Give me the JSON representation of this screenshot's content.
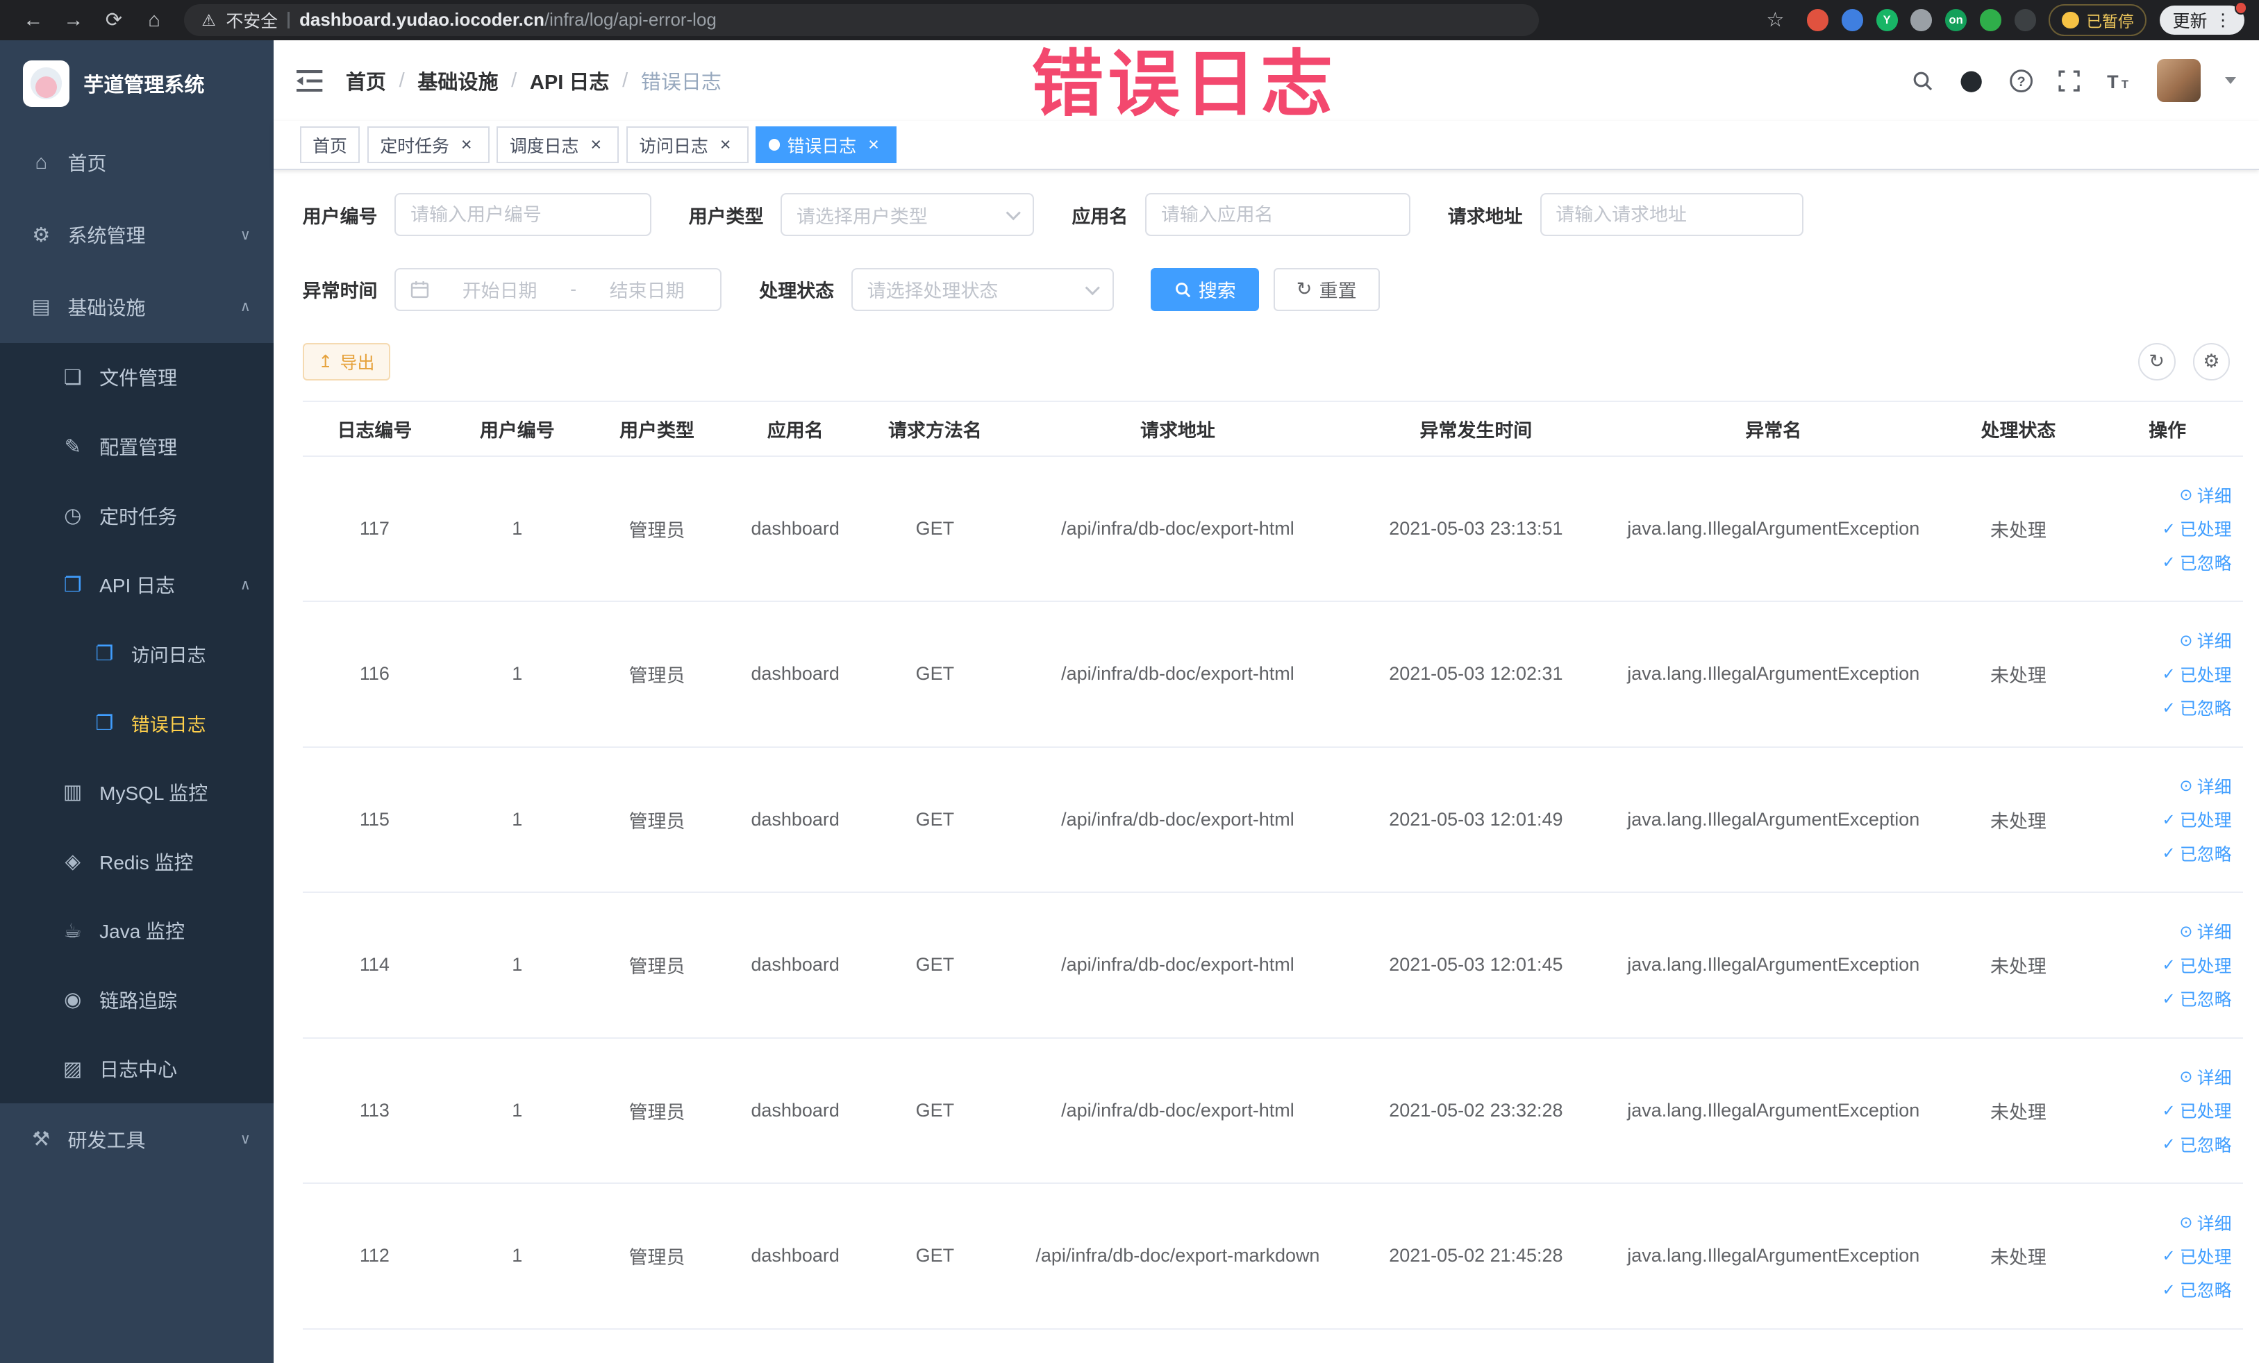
{
  "browser": {
    "security_label": "不安全",
    "url_host": "dashboard.yudao.iocoder.cn",
    "url_path": "/infra/log/api-error-log",
    "paused_badge": "已暂停",
    "update_label": "更新",
    "extensions": [
      {
        "name": "extension-red",
        "color": "#e0523f",
        "label": ""
      },
      {
        "name": "extension-blue",
        "color": "#3f7fe0",
        "label": ""
      },
      {
        "name": "extension-teal",
        "color": "#18b566",
        "label": "Y"
      },
      {
        "name": "extension-gray-puzzle",
        "color": "#9aa0a6",
        "label": ""
      },
      {
        "name": "extension-on-switch",
        "color": "#14a05a",
        "label": "on"
      },
      {
        "name": "extension-green",
        "color": "#2fae4a",
        "label": ""
      },
      {
        "name": "extension-dark",
        "color": "#3c4043",
        "label": ""
      }
    ]
  },
  "sidebar": {
    "title": "芋道管理系统",
    "items": [
      {
        "label": "首页",
        "icon": "home-icon",
        "glyph": "⌂",
        "level": 1
      },
      {
        "label": "系统管理",
        "icon": "gear-icon",
        "glyph": "⚙",
        "level": 1,
        "arrow": "down"
      },
      {
        "label": "基础设施",
        "icon": "infrastructure-icon",
        "glyph": "▤",
        "level": 1,
        "arrow": "up"
      },
      {
        "label": "文件管理",
        "icon": "file-manage-icon",
        "glyph": "❏",
        "level": 2
      },
      {
        "label": "配置管理",
        "icon": "config-manage-icon",
        "glyph": "✎",
        "level": 2
      },
      {
        "label": "定时任务",
        "icon": "scheduled-job-icon",
        "glyph": "◷",
        "level": 2
      },
      {
        "label": "API 日志",
        "icon": "api-log-icon",
        "glyph": "❐",
        "level": 2,
        "arrow": "up",
        "iconColor": "#409eff"
      },
      {
        "label": "访问日志",
        "icon": "access-log-icon",
        "glyph": "❐",
        "level": 3,
        "iconColor": "#409eff"
      },
      {
        "label": "错误日志",
        "icon": "error-log-icon",
        "glyph": "❐",
        "level": 3,
        "active": true,
        "iconColor": "#409eff"
      },
      {
        "label": "MySQL 监控",
        "icon": "mysql-monitor-icon",
        "glyph": "▥",
        "level": 2
      },
      {
        "label": "Redis 监控",
        "icon": "redis-monitor-icon",
        "glyph": "◈",
        "level": 2
      },
      {
        "label": "Java 监控",
        "icon": "java-monitor-icon",
        "glyph": "☕",
        "level": 2
      },
      {
        "label": "链路追踪",
        "icon": "trace-icon",
        "glyph": "◉",
        "level": 2
      },
      {
        "label": "日志中心",
        "icon": "log-center-icon",
        "glyph": "▨",
        "level": 2
      },
      {
        "label": "研发工具",
        "icon": "devtools-icon",
        "glyph": "⚒",
        "level": 1,
        "arrow": "down"
      }
    ]
  },
  "header": {
    "breadcrumb": [
      "首页",
      "基础设施",
      "API 日志",
      "错误日志"
    ]
  },
  "watermark": "错误日志",
  "tabs": [
    {
      "label": "首页",
      "closable": false,
      "active": false
    },
    {
      "label": "定时任务",
      "closable": true,
      "active": false
    },
    {
      "label": "调度日志",
      "closable": true,
      "active": false
    },
    {
      "label": "访问日志",
      "closable": true,
      "active": false
    },
    {
      "label": "错误日志",
      "closable": true,
      "active": true
    }
  ],
  "filters": {
    "user_id": {
      "label": "用户编号",
      "placeholder": "请输入用户编号"
    },
    "user_type": {
      "label": "用户类型",
      "placeholder": "请选择用户类型"
    },
    "app_name": {
      "label": "应用名",
      "placeholder": "请输入应用名"
    },
    "request_url": {
      "label": "请求地址",
      "placeholder": "请输入请求地址"
    },
    "exception_time": {
      "label": "异常时间",
      "start_placeholder": "开始日期",
      "separator": "-",
      "end_placeholder": "结束日期"
    },
    "process_status": {
      "label": "处理状态",
      "placeholder": "请选择处理状态"
    },
    "search_label": "搜索",
    "reset_label": "重置"
  },
  "toolbar": {
    "export_label": "导出"
  },
  "table": {
    "headers": [
      "日志编号",
      "用户编号",
      "用户类型",
      "应用名",
      "请求方法名",
      "请求地址",
      "异常发生时间",
      "异常名",
      "处理状态",
      "操作"
    ],
    "actions": [
      "详细",
      "已处理",
      "已忽略"
    ],
    "rows": [
      {
        "id": "117",
        "user_id": "1",
        "user_type": "管理员",
        "app": "dashboard",
        "method": "GET",
        "url": "/api/infra/db-doc/export-html",
        "time": "2021-05-03 23:13:51",
        "exception": "java.lang.IllegalArgumentException",
        "status": "未处理"
      },
      {
        "id": "116",
        "user_id": "1",
        "user_type": "管理员",
        "app": "dashboard",
        "method": "GET",
        "url": "/api/infra/db-doc/export-html",
        "time": "2021-05-03 12:02:31",
        "exception": "java.lang.IllegalArgumentException",
        "status": "未处理"
      },
      {
        "id": "115",
        "user_id": "1",
        "user_type": "管理员",
        "app": "dashboard",
        "method": "GET",
        "url": "/api/infra/db-doc/export-html",
        "time": "2021-05-03 12:01:49",
        "exception": "java.lang.IllegalArgumentException",
        "status": "未处理"
      },
      {
        "id": "114",
        "user_id": "1",
        "user_type": "管理员",
        "app": "dashboard",
        "method": "GET",
        "url": "/api/infra/db-doc/export-html",
        "time": "2021-05-03 12:01:45",
        "exception": "java.lang.IllegalArgumentException",
        "status": "未处理"
      },
      {
        "id": "113",
        "user_id": "1",
        "user_type": "管理员",
        "app": "dashboard",
        "method": "GET",
        "url": "/api/infra/db-doc/export-html",
        "time": "2021-05-02 23:32:28",
        "exception": "java.lang.IllegalArgumentException",
        "status": "未处理"
      },
      {
        "id": "112",
        "user_id": "1",
        "user_type": "管理员",
        "app": "dashboard",
        "method": "GET",
        "url": "/api/infra/db-doc/export-markdown",
        "time": "2021-05-02 21:45:28",
        "exception": "java.lang.IllegalArgumentException",
        "status": "未处理"
      }
    ]
  },
  "colors": {
    "primary": "#409eff",
    "active_menu": "#ffd04b",
    "watermark": "#f3486e",
    "warning": "#e6a23c",
    "sidebar_bg": "#304156",
    "submenu_bg": "#1f2d3d"
  }
}
